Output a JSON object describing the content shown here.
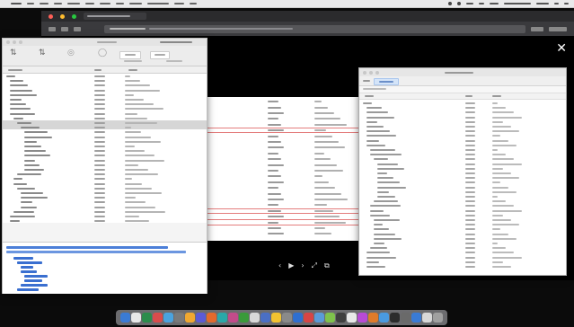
{
  "colors": {
    "highlight": "#e47d7d",
    "accent": "#2b6fd6",
    "window_chrome": "#2b2b2d"
  },
  "icons": {
    "apple": "apple-icon",
    "prev": "previous-icon",
    "play": "play-icon",
    "next": "next-icon",
    "fullscreen": "fullscreen-icon",
    "share": "share-icon",
    "close": "close-icon"
  },
  "media_controls": {
    "prev": "‹",
    "play": "▶",
    "next": "›",
    "fullscreen": "⤢",
    "share": "⧉"
  },
  "browser": {
    "close_glyph": "✕"
  }
}
